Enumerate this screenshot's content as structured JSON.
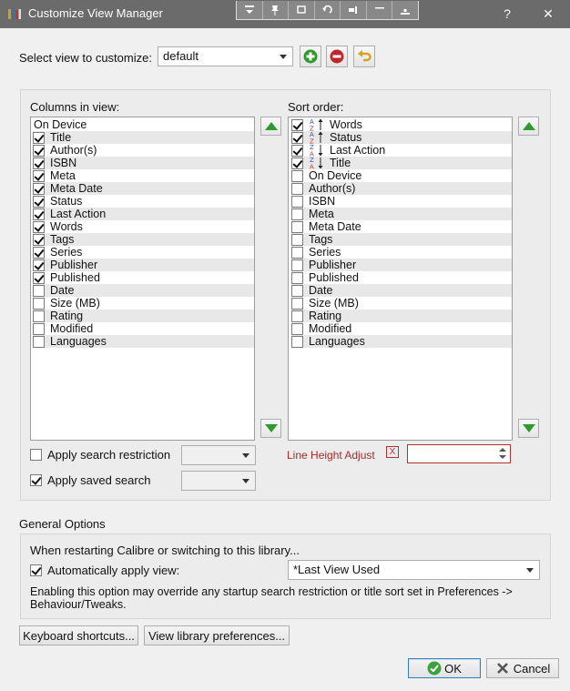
{
  "window": {
    "title": "Customize View Manager",
    "help_label": "?",
    "close_label": "✕"
  },
  "view_select": {
    "label": "Select view to customize:",
    "value": "default"
  },
  "columns": {
    "header": "Columns in view:",
    "items": [
      {
        "label": "On Device",
        "checked": null
      },
      {
        "label": "Title",
        "checked": true
      },
      {
        "label": "Author(s)",
        "checked": true
      },
      {
        "label": "ISBN",
        "checked": true
      },
      {
        "label": "Meta",
        "checked": true
      },
      {
        "label": "Meta Date",
        "checked": true
      },
      {
        "label": "Status",
        "checked": true
      },
      {
        "label": "Last Action",
        "checked": true
      },
      {
        "label": "Words",
        "checked": true
      },
      {
        "label": "Tags",
        "checked": true
      },
      {
        "label": "Series",
        "checked": true
      },
      {
        "label": "Publisher",
        "checked": true
      },
      {
        "label": "Published",
        "checked": true
      },
      {
        "label": "Date",
        "checked": false
      },
      {
        "label": "Size (MB)",
        "checked": false
      },
      {
        "label": "Rating",
        "checked": false
      },
      {
        "label": "Modified",
        "checked": false
      },
      {
        "label": "Languages",
        "checked": false
      }
    ]
  },
  "sort": {
    "header": "Sort order:",
    "items": [
      {
        "label": "Words",
        "checked": true,
        "direction": "asc"
      },
      {
        "label": "Status",
        "checked": true,
        "direction": "asc"
      },
      {
        "label": "Last Action",
        "checked": true,
        "direction": "desc"
      },
      {
        "label": "Title",
        "checked": true,
        "direction": "desc"
      },
      {
        "label": "On Device",
        "checked": false
      },
      {
        "label": "Author(s)",
        "checked": false
      },
      {
        "label": "ISBN",
        "checked": false
      },
      {
        "label": "Meta",
        "checked": false
      },
      {
        "label": "Meta Date",
        "checked": false
      },
      {
        "label": "Tags",
        "checked": false
      },
      {
        "label": "Series",
        "checked": false
      },
      {
        "label": "Publisher",
        "checked": false
      },
      {
        "label": "Published",
        "checked": false
      },
      {
        "label": "Date",
        "checked": false
      },
      {
        "label": "Size (MB)",
        "checked": false
      },
      {
        "label": "Rating",
        "checked": false
      },
      {
        "label": "Modified",
        "checked": false
      },
      {
        "label": "Languages",
        "checked": false
      }
    ]
  },
  "restriction": {
    "apply_search_restriction_label": "Apply search restriction",
    "apply_search_restriction_checked": false,
    "apply_saved_search_label": "Apply saved search",
    "apply_saved_search_checked": true,
    "restriction_value": "",
    "saved_search_value": ""
  },
  "line_height": {
    "label": "Line Height Adjust",
    "x_label": "X",
    "value": ""
  },
  "general": {
    "header": "General Options",
    "note_restart": "When restarting Calibre or switching to this library...",
    "auto_apply_label": "Automatically apply view:",
    "auto_apply_checked": true,
    "auto_apply_value": "*Last View Used",
    "note_override_line1": "Enabling this option may override any startup search restriction or title sort set in Preferences ->",
    "note_override_line2": "Behaviour/Tweaks."
  },
  "buttons": {
    "keyboard_shortcuts": "Keyboard shortcuts...",
    "view_library_prefs": "View library preferences...",
    "ok": "OK",
    "cancel": "Cancel"
  },
  "colors": {
    "titlebar": "#6b6b6b",
    "accent_green": "#2f9a2f",
    "warning_red": "#a52a2a"
  }
}
